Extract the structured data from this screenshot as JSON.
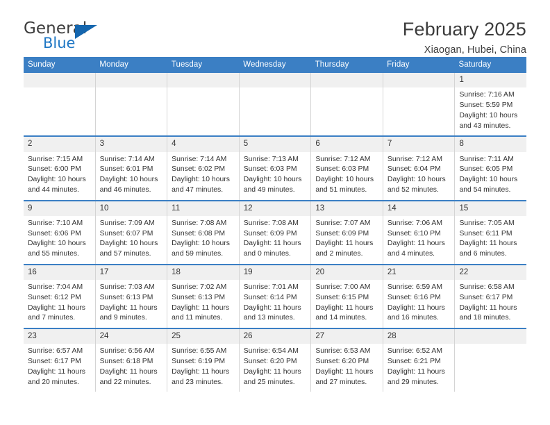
{
  "brand": {
    "name_part1": "General",
    "name_part2": "Blue",
    "triangle_color": "#1566ae",
    "blue_text_color": "#1f77c4"
  },
  "header": {
    "title": "February 2025",
    "subtitle": "Xiaogan, Hubei, China"
  },
  "theme": {
    "header_bg": "#3b7fc4",
    "header_text": "#ffffff",
    "daynum_bg": "#f0f0f0",
    "cell_border": "#d4d4d4",
    "row_border": "#3b7fc4"
  },
  "weekdays": [
    "Sunday",
    "Monday",
    "Tuesday",
    "Wednesday",
    "Thursday",
    "Friday",
    "Saturday"
  ],
  "weeks": [
    [
      {
        "day": "",
        "empty": true,
        "sunrise": "",
        "sunset": "",
        "daylight_line1": "",
        "daylight_line2": ""
      },
      {
        "day": "",
        "empty": true,
        "sunrise": "",
        "sunset": "",
        "daylight_line1": "",
        "daylight_line2": ""
      },
      {
        "day": "",
        "empty": true,
        "sunrise": "",
        "sunset": "",
        "daylight_line1": "",
        "daylight_line2": ""
      },
      {
        "day": "",
        "empty": true,
        "sunrise": "",
        "sunset": "",
        "daylight_line1": "",
        "daylight_line2": ""
      },
      {
        "day": "",
        "empty": true,
        "sunrise": "",
        "sunset": "",
        "daylight_line1": "",
        "daylight_line2": ""
      },
      {
        "day": "",
        "empty": true,
        "sunrise": "",
        "sunset": "",
        "daylight_line1": "",
        "daylight_line2": ""
      },
      {
        "day": "1",
        "empty": false,
        "sunrise": "Sunrise: 7:16 AM",
        "sunset": "Sunset: 5:59 PM",
        "daylight_line1": "Daylight: 10 hours",
        "daylight_line2": "and 43 minutes."
      }
    ],
    [
      {
        "day": "2",
        "empty": false,
        "sunrise": "Sunrise: 7:15 AM",
        "sunset": "Sunset: 6:00 PM",
        "daylight_line1": "Daylight: 10 hours",
        "daylight_line2": "and 44 minutes."
      },
      {
        "day": "3",
        "empty": false,
        "sunrise": "Sunrise: 7:14 AM",
        "sunset": "Sunset: 6:01 PM",
        "daylight_line1": "Daylight: 10 hours",
        "daylight_line2": "and 46 minutes."
      },
      {
        "day": "4",
        "empty": false,
        "sunrise": "Sunrise: 7:14 AM",
        "sunset": "Sunset: 6:02 PM",
        "daylight_line1": "Daylight: 10 hours",
        "daylight_line2": "and 47 minutes."
      },
      {
        "day": "5",
        "empty": false,
        "sunrise": "Sunrise: 7:13 AM",
        "sunset": "Sunset: 6:03 PM",
        "daylight_line1": "Daylight: 10 hours",
        "daylight_line2": "and 49 minutes."
      },
      {
        "day": "6",
        "empty": false,
        "sunrise": "Sunrise: 7:12 AM",
        "sunset": "Sunset: 6:03 PM",
        "daylight_line1": "Daylight: 10 hours",
        "daylight_line2": "and 51 minutes."
      },
      {
        "day": "7",
        "empty": false,
        "sunrise": "Sunrise: 7:12 AM",
        "sunset": "Sunset: 6:04 PM",
        "daylight_line1": "Daylight: 10 hours",
        "daylight_line2": "and 52 minutes."
      },
      {
        "day": "8",
        "empty": false,
        "sunrise": "Sunrise: 7:11 AM",
        "sunset": "Sunset: 6:05 PM",
        "daylight_line1": "Daylight: 10 hours",
        "daylight_line2": "and 54 minutes."
      }
    ],
    [
      {
        "day": "9",
        "empty": false,
        "sunrise": "Sunrise: 7:10 AM",
        "sunset": "Sunset: 6:06 PM",
        "daylight_line1": "Daylight: 10 hours",
        "daylight_line2": "and 55 minutes."
      },
      {
        "day": "10",
        "empty": false,
        "sunrise": "Sunrise: 7:09 AM",
        "sunset": "Sunset: 6:07 PM",
        "daylight_line1": "Daylight: 10 hours",
        "daylight_line2": "and 57 minutes."
      },
      {
        "day": "11",
        "empty": false,
        "sunrise": "Sunrise: 7:08 AM",
        "sunset": "Sunset: 6:08 PM",
        "daylight_line1": "Daylight: 10 hours",
        "daylight_line2": "and 59 minutes."
      },
      {
        "day": "12",
        "empty": false,
        "sunrise": "Sunrise: 7:08 AM",
        "sunset": "Sunset: 6:09 PM",
        "daylight_line1": "Daylight: 11 hours",
        "daylight_line2": "and 0 minutes."
      },
      {
        "day": "13",
        "empty": false,
        "sunrise": "Sunrise: 7:07 AM",
        "sunset": "Sunset: 6:09 PM",
        "daylight_line1": "Daylight: 11 hours",
        "daylight_line2": "and 2 minutes."
      },
      {
        "day": "14",
        "empty": false,
        "sunrise": "Sunrise: 7:06 AM",
        "sunset": "Sunset: 6:10 PM",
        "daylight_line1": "Daylight: 11 hours",
        "daylight_line2": "and 4 minutes."
      },
      {
        "day": "15",
        "empty": false,
        "sunrise": "Sunrise: 7:05 AM",
        "sunset": "Sunset: 6:11 PM",
        "daylight_line1": "Daylight: 11 hours",
        "daylight_line2": "and 6 minutes."
      }
    ],
    [
      {
        "day": "16",
        "empty": false,
        "sunrise": "Sunrise: 7:04 AM",
        "sunset": "Sunset: 6:12 PM",
        "daylight_line1": "Daylight: 11 hours",
        "daylight_line2": "and 7 minutes."
      },
      {
        "day": "17",
        "empty": false,
        "sunrise": "Sunrise: 7:03 AM",
        "sunset": "Sunset: 6:13 PM",
        "daylight_line1": "Daylight: 11 hours",
        "daylight_line2": "and 9 minutes."
      },
      {
        "day": "18",
        "empty": false,
        "sunrise": "Sunrise: 7:02 AM",
        "sunset": "Sunset: 6:13 PM",
        "daylight_line1": "Daylight: 11 hours",
        "daylight_line2": "and 11 minutes."
      },
      {
        "day": "19",
        "empty": false,
        "sunrise": "Sunrise: 7:01 AM",
        "sunset": "Sunset: 6:14 PM",
        "daylight_line1": "Daylight: 11 hours",
        "daylight_line2": "and 13 minutes."
      },
      {
        "day": "20",
        "empty": false,
        "sunrise": "Sunrise: 7:00 AM",
        "sunset": "Sunset: 6:15 PM",
        "daylight_line1": "Daylight: 11 hours",
        "daylight_line2": "and 14 minutes."
      },
      {
        "day": "21",
        "empty": false,
        "sunrise": "Sunrise: 6:59 AM",
        "sunset": "Sunset: 6:16 PM",
        "daylight_line1": "Daylight: 11 hours",
        "daylight_line2": "and 16 minutes."
      },
      {
        "day": "22",
        "empty": false,
        "sunrise": "Sunrise: 6:58 AM",
        "sunset": "Sunset: 6:17 PM",
        "daylight_line1": "Daylight: 11 hours",
        "daylight_line2": "and 18 minutes."
      }
    ],
    [
      {
        "day": "23",
        "empty": false,
        "sunrise": "Sunrise: 6:57 AM",
        "sunset": "Sunset: 6:17 PM",
        "daylight_line1": "Daylight: 11 hours",
        "daylight_line2": "and 20 minutes."
      },
      {
        "day": "24",
        "empty": false,
        "sunrise": "Sunrise: 6:56 AM",
        "sunset": "Sunset: 6:18 PM",
        "daylight_line1": "Daylight: 11 hours",
        "daylight_line2": "and 22 minutes."
      },
      {
        "day": "25",
        "empty": false,
        "sunrise": "Sunrise: 6:55 AM",
        "sunset": "Sunset: 6:19 PM",
        "daylight_line1": "Daylight: 11 hours",
        "daylight_line2": "and 23 minutes."
      },
      {
        "day": "26",
        "empty": false,
        "sunrise": "Sunrise: 6:54 AM",
        "sunset": "Sunset: 6:20 PM",
        "daylight_line1": "Daylight: 11 hours",
        "daylight_line2": "and 25 minutes."
      },
      {
        "day": "27",
        "empty": false,
        "sunrise": "Sunrise: 6:53 AM",
        "sunset": "Sunset: 6:20 PM",
        "daylight_line1": "Daylight: 11 hours",
        "daylight_line2": "and 27 minutes."
      },
      {
        "day": "28",
        "empty": false,
        "sunrise": "Sunrise: 6:52 AM",
        "sunset": "Sunset: 6:21 PM",
        "daylight_line1": "Daylight: 11 hours",
        "daylight_line2": "and 29 minutes."
      },
      {
        "day": "",
        "empty": true,
        "sunrise": "",
        "sunset": "",
        "daylight_line1": "",
        "daylight_line2": ""
      }
    ]
  ]
}
